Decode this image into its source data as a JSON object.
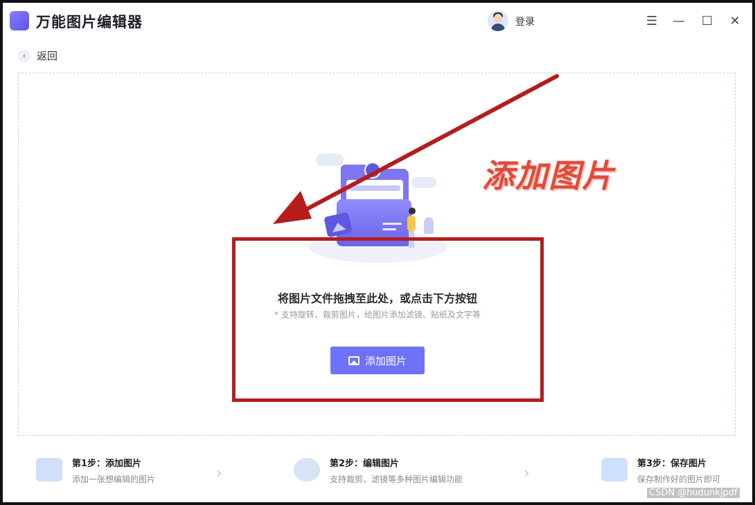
{
  "app": {
    "title": "万能图片编辑器",
    "login_label": "登录"
  },
  "window_controls": {
    "menu_icon": "hamburger-icon",
    "minimize_icon": "minimize-icon",
    "maximize_icon": "maximize-icon",
    "close_icon": "close-icon"
  },
  "nav": {
    "back_label": "返回"
  },
  "dropzone": {
    "main_hint": "将图片文件拖拽至此处，或点击下方按钮",
    "sub_hint": "* 支持旋转、裁剪图片，给图片添加滤镜、贴纸及文字等",
    "add_button_label": "添加图片"
  },
  "annotation": {
    "text": "添加图片",
    "color": "#b51d1d"
  },
  "steps": [
    {
      "title": "第1步：添加图片",
      "desc": "添加一张想编辑的图片"
    },
    {
      "title": "第2步：编辑图片",
      "desc": "支持裁剪、滤镜等多种图片编辑功能"
    },
    {
      "title": "第3步：保存图片",
      "desc": "保存制作好的图片即可"
    }
  ],
  "watermark": "CSDN @hudunkjpdf",
  "colors": {
    "accent": "#6f72f7",
    "annotation_red": "#b51d1d",
    "annotation_text": "#e24a3b"
  }
}
